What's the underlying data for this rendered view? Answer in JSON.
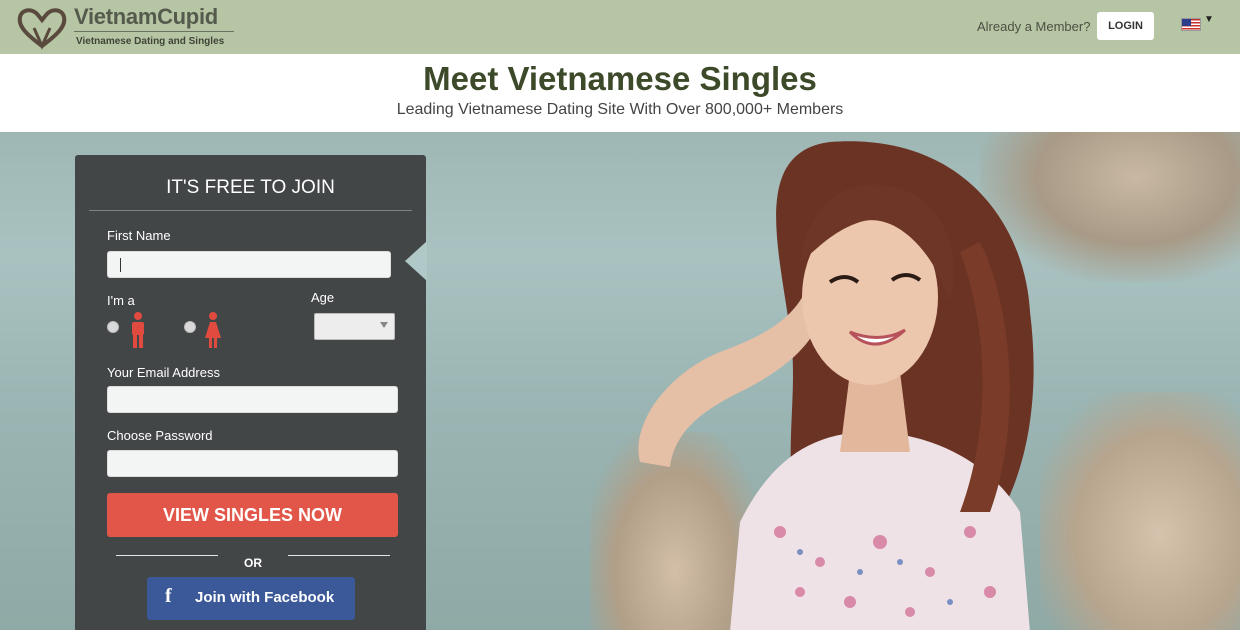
{
  "brand": {
    "name": "VietnamCupid",
    "tagline": "Vietnamese Dating and Singles",
    "color_primary": "#b6c5a4"
  },
  "topbar": {
    "member_prompt": "Already a Member?",
    "login_label": "LOGIN",
    "language_icon": "us-flag-icon"
  },
  "header": {
    "title": "Meet Vietnamese Singles",
    "subtitle": "Leading Vietnamese Dating Site With Over 800,000+ Members"
  },
  "join_form": {
    "title": "IT'S FREE TO JOIN",
    "first_name_label": "First Name",
    "first_name_value": "",
    "gender_label": "I'm a",
    "gender_options": [
      "male-icon",
      "female-icon"
    ],
    "age_label": "Age",
    "age_value": "",
    "email_label": "Your Email Address",
    "email_value": "",
    "password_label": "Choose Password",
    "password_value": "",
    "submit_label": "VIEW SINGLES NOW",
    "submit_color": "#e25549",
    "or_label": "OR",
    "facebook_label": "Join with Facebook",
    "facebook_icon": "f",
    "facebook_color": "#3b5998"
  }
}
